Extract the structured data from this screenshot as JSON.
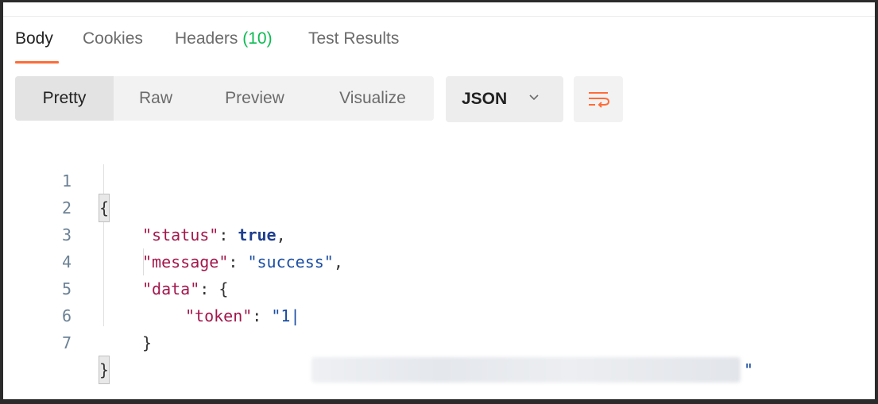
{
  "response_tabs": {
    "body": "Body",
    "cookies": "Cookies",
    "headers_label": "Headers",
    "headers_count": "(10)",
    "test_results": "Test Results"
  },
  "view_modes": {
    "pretty": "Pretty",
    "raw": "Raw",
    "preview": "Preview",
    "visualize": "Visualize"
  },
  "format_select": {
    "selected": "JSON"
  },
  "wrap_button": {
    "icon": "wrap-lines-icon"
  },
  "code_lines": [
    {
      "num": "1",
      "text": "{"
    },
    {
      "num": "2",
      "key": "\"status\"",
      "sep": ": ",
      "value": "true",
      "end": ","
    },
    {
      "num": "3",
      "key": "\"message\"",
      "sep": ": ",
      "value": "\"success\"",
      "end": ","
    },
    {
      "num": "4",
      "key": "\"data\"",
      "sep": ": ",
      "value": "{"
    },
    {
      "num": "5",
      "key": "\"token\"",
      "sep": ": ",
      "value": "\"1|",
      "end": "\""
    },
    {
      "num": "6",
      "text": "}"
    },
    {
      "num": "7",
      "text": "}"
    }
  ],
  "colors": {
    "accent": "#ff6c37",
    "count_green": "#0cbb52",
    "json_key": "#a3174b",
    "json_string": "#1a4ea3"
  }
}
